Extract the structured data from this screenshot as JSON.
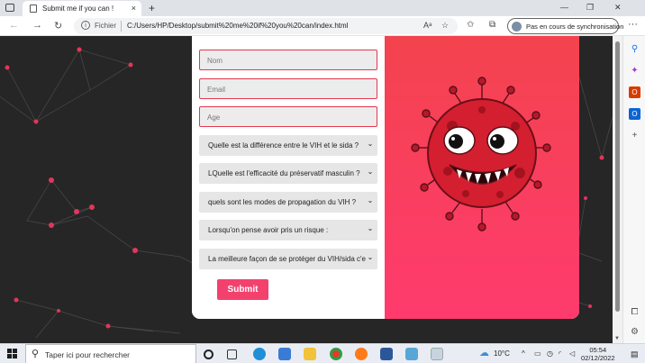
{
  "browser": {
    "tab_title": "Submit me if you can !",
    "tab_close": "×",
    "new_tab": "+",
    "min": "—",
    "max": "❐",
    "close": "✕",
    "url_label": "Fichier",
    "url": "C:/Users/HP/Desktop/submit%20me%20if%20you%20can/index.html",
    "sync_label": "Pas en cours de synchronisation",
    "more": "···"
  },
  "form": {
    "name_placeholder": "Nom",
    "email_placeholder": "Email",
    "age_placeholder": "Age",
    "selects": [
      "Quelle est la différence entre le VIH et le sida ?",
      "LQuelle est l'efficacité du préservatif masculin ?",
      "quels sont les modes de propagation du VIH ?",
      "Lorsqu'on pense avoir pris un risque :",
      "La meilleure façon de se protéger du VIH/sida c'est"
    ],
    "submit_label": "Submit"
  },
  "taskbar": {
    "search_placeholder": "Taper ici pour rechercher",
    "weather": "10°C",
    "time": "05:54",
    "date": "02/12/2022"
  },
  "colors": {
    "accent": "#f3416e",
    "field_border": "#e2374e",
    "background": "#262626",
    "network_node": "#e0375a"
  },
  "icons": [
    "back-arrow-icon",
    "forward-arrow-icon",
    "refresh-icon",
    "info-icon",
    "read-aloud-icon",
    "favorite-icon",
    "collections-icon",
    "search-icon",
    "windows-icon",
    "chevron-down-icon"
  ]
}
